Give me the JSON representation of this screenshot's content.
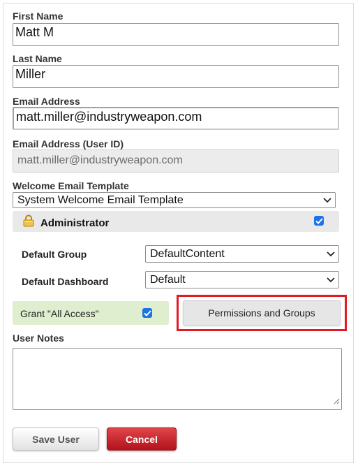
{
  "form": {
    "first_name": {
      "label": "First Name",
      "value": "Matt M"
    },
    "last_name": {
      "label": "Last Name",
      "value": "Miller"
    },
    "email": {
      "label": "Email Address",
      "value": "matt.miller@industryweapon.com"
    },
    "user_id": {
      "label": "Email Address (User ID)",
      "value": "matt.miller@industryweapon.com"
    },
    "welcome_template": {
      "label": "Welcome Email Template",
      "selected": "System Welcome Email Template"
    },
    "administrator": {
      "label": "Administrator",
      "checked": true,
      "icon": "lock-icon"
    },
    "default_group": {
      "label": "Default Group",
      "selected": "DefaultContent"
    },
    "default_dashboard": {
      "label": "Default Dashboard",
      "selected": "Default"
    },
    "all_access": {
      "label": "Grant \"All Access\"",
      "checked": true
    },
    "permissions_button": {
      "label": "Permissions and Groups"
    },
    "user_notes": {
      "label": "User Notes",
      "value": ""
    }
  },
  "actions": {
    "save_label": "Save User",
    "cancel_label": "Cancel"
  },
  "colors": {
    "highlight": "#e11b22",
    "checkbox": "#1a73e8",
    "cancel": "#c4171f",
    "all_access_bg": "#dfeece"
  }
}
